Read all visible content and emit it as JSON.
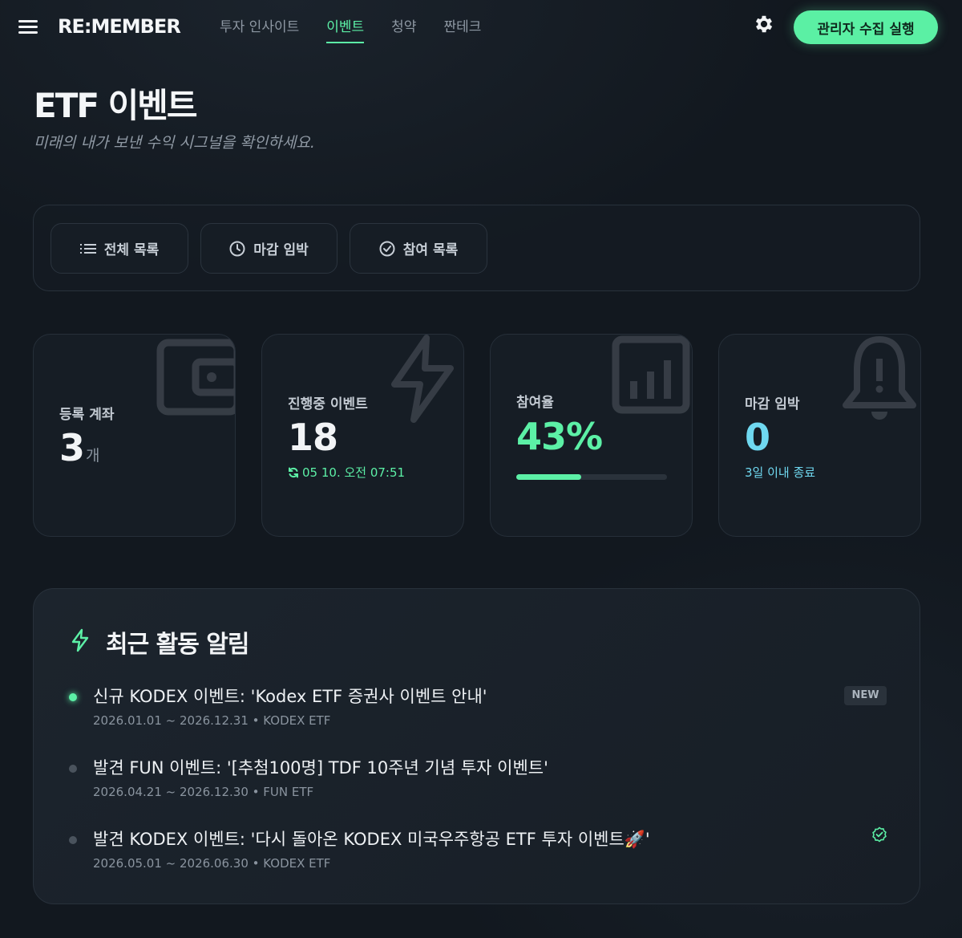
{
  "header": {
    "logo": "RE:MEMBER",
    "nav": [
      "투자 인사이트",
      "이벤트",
      "청약",
      "짠테크"
    ],
    "active_nav": "이벤트",
    "admin_button": "관리자 수집 실행"
  },
  "page": {
    "title": "ETF 이벤트",
    "subtitle": "미래의 내가 보낸 수익 시그널을 확인하세요."
  },
  "filters": {
    "all": "전체 목록",
    "deadline": "마감 임박",
    "joined": "참여 목록"
  },
  "stats": {
    "accounts": {
      "label": "등록 계좌",
      "value": "3",
      "unit": "개"
    },
    "active": {
      "label": "진행중 이벤트",
      "value": "18",
      "note": "05 10. 오전 07:51"
    },
    "participation": {
      "label": "참여율",
      "value": "43%",
      "progress": 0.43
    },
    "deadline": {
      "label": "마감 임박",
      "value": "0",
      "note": "3일 이내 종료"
    }
  },
  "activity": {
    "title": "최근 활동 알림",
    "items": [
      {
        "text": "신규 KODEX 이벤트: 'Kodex ETF 증권사 이벤트 안내'",
        "meta": "2026.01.01 ~ 2026.12.31 • KODEX ETF",
        "badge": "NEW"
      },
      {
        "text": "발견 FUN 이벤트: '[추첨100명] TDF 10주년 기념 투자 이벤트'",
        "meta": "2026.04.21 ~ 2026.12.30 • FUN ETF"
      },
      {
        "text": "발견 KODEX 이벤트: '다시 돌아온 KODEX 미국우주항공 ETF 투자 이벤트🚀'",
        "meta": "2026.05.01 ~ 2026.06.30 • KODEX ETF"
      }
    ]
  },
  "colors": {
    "accent": "#5cf0a6",
    "cyan": "#6fd8f0",
    "background": "#12181f"
  }
}
